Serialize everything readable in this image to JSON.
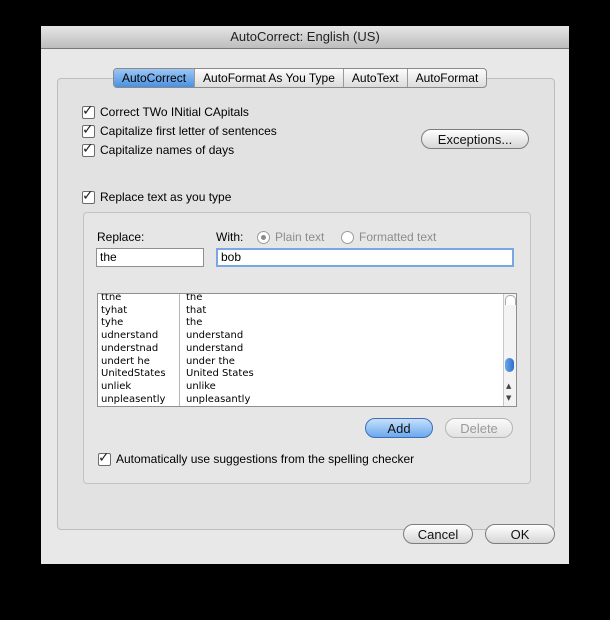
{
  "window": {
    "title": "AutoCorrect: English (US)"
  },
  "tabs": [
    "AutoCorrect",
    "AutoFormat As You Type",
    "AutoText",
    "AutoFormat"
  ],
  "options": {
    "correct_two_initials": "Correct TWo INitial CApitals",
    "capitalize_first": "Capitalize first letter of sentences",
    "capitalize_days": "Capitalize names of days",
    "replace_as_you_type": "Replace text as you type",
    "auto_suggestions": "Automatically use suggestions from the spelling checker"
  },
  "buttons": {
    "exceptions": "Exceptions...",
    "add": "Add",
    "delete": "Delete",
    "cancel": "Cancel",
    "ok": "OK"
  },
  "replace": {
    "replace_label": "Replace:",
    "with_label": "With:",
    "plain_text": "Plain text",
    "formatted_text": "Formatted text",
    "replace_value": "the",
    "with_value": "bob"
  },
  "entries": [
    {
      "from": "ttne",
      "to": "the"
    },
    {
      "from": "tyhat",
      "to": "that"
    },
    {
      "from": "tyhe",
      "to": "the"
    },
    {
      "from": "udnerstand",
      "to": "understand"
    },
    {
      "from": "understnad",
      "to": "understand"
    },
    {
      "from": "undert he",
      "to": "under the"
    },
    {
      "from": "UnitedStates",
      "to": "United States"
    },
    {
      "from": "unliek",
      "to": "unlike"
    },
    {
      "from": "unpleasently",
      "to": "unpleasantly"
    }
  ],
  "icons": {
    "checkmark": "checkmark-icon",
    "scroll_up": "scroll-up-icon",
    "scroll_down": "scroll-down-icon"
  }
}
